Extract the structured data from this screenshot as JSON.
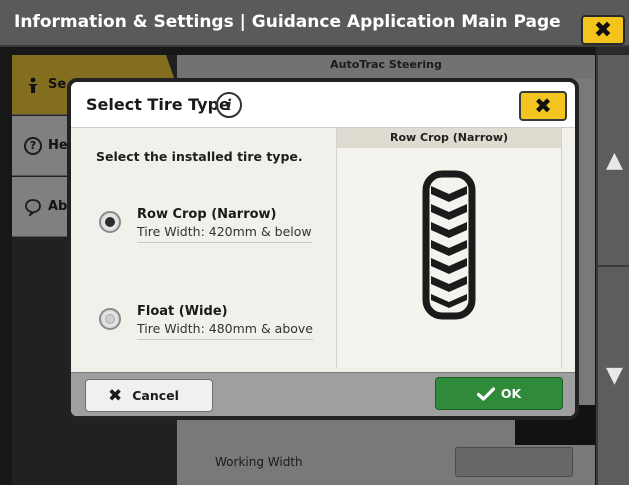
{
  "app": {
    "title": "Information & Settings | Guidance Application Main Page",
    "close_label": "✖"
  },
  "sidebar": {
    "tabs": [
      {
        "label": "Se",
        "icon": "person-icon",
        "active": true
      },
      {
        "label": "He",
        "icon": "help-icon",
        "active": false
      },
      {
        "label": "Ab",
        "icon": "about-icon",
        "active": false
      }
    ]
  },
  "main": {
    "section_header": "AutoTrac Steering",
    "bottom_label": "Working Width"
  },
  "scroll": {
    "up_label": "▲",
    "down_label": "▼"
  },
  "modal": {
    "title": "Select Tire Type",
    "info_icon": "i",
    "close_label": "✖",
    "prompt": "Select the installed tire type.",
    "options": [
      {
        "name": "Row Crop (Narrow)",
        "detail": "Tire Width: 420mm & below",
        "selected": true
      },
      {
        "name": "Float (Wide)",
        "detail": "Tire Width: 480mm & above",
        "selected": false
      }
    ],
    "preview_title": "Row Crop (Narrow)",
    "cancel_label": "Cancel",
    "ok_label": "OK"
  },
  "colors": {
    "accent_yellow": "#f4c520",
    "ok_green": "#2f8a3a"
  }
}
